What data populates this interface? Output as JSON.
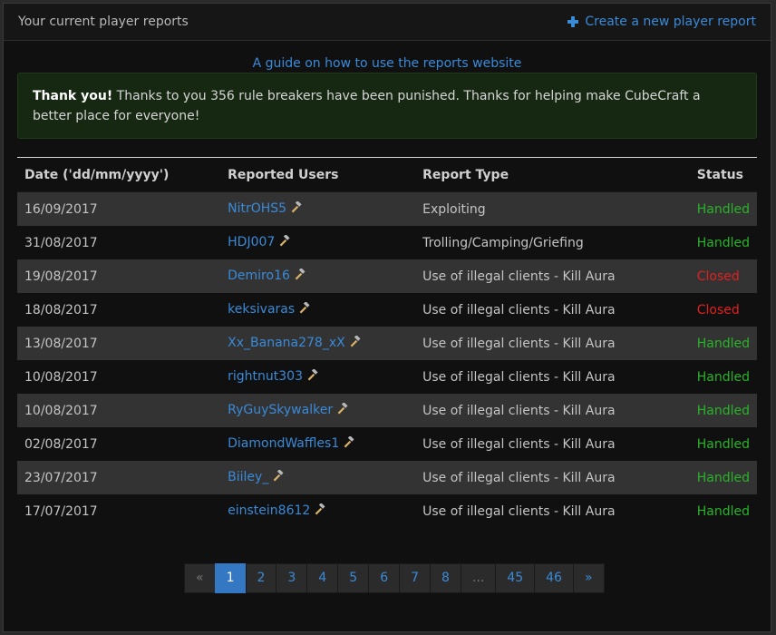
{
  "header": {
    "title": "Your current player reports",
    "create_label": "Create a new player report"
  },
  "guide_link": "A guide on how to use the reports website",
  "alert": {
    "strong": "Thank you!",
    "text": " Thanks to you 356 rule breakers have been punished. Thanks for helping make CubeCraft a better place for everyone!"
  },
  "table": {
    "columns": [
      "Date ('dd/mm/yyyy')",
      "Reported Users",
      "Report Type",
      "Status"
    ],
    "rows": [
      {
        "date": "16/09/2017",
        "user": "NitrOHS5",
        "type": "Exploiting",
        "status": "Handled"
      },
      {
        "date": "31/08/2017",
        "user": "HDJ007",
        "type": "Trolling/Camping/Griefing",
        "status": "Handled"
      },
      {
        "date": "19/08/2017",
        "user": "Demiro16",
        "type": "Use of illegal clients - Kill Aura",
        "status": "Closed"
      },
      {
        "date": "18/08/2017",
        "user": "keksivaras",
        "type": "Use of illegal clients - Kill Aura",
        "status": "Closed"
      },
      {
        "date": "13/08/2017",
        "user": "Xx_Banana278_xX",
        "type": "Use of illegal clients - Kill Aura",
        "status": "Handled"
      },
      {
        "date": "10/08/2017",
        "user": "rightnut303",
        "type": "Use of illegal clients - Kill Aura",
        "status": "Handled"
      },
      {
        "date": "10/08/2017",
        "user": "RyGuySkywalker",
        "type": "Use of illegal clients - Kill Aura",
        "status": "Handled"
      },
      {
        "date": "02/08/2017",
        "user": "DiamondWaffles1",
        "type": "Use of illegal clients - Kill Aura",
        "status": "Handled"
      },
      {
        "date": "23/07/2017",
        "user": "Biiley_",
        "type": "Use of illegal clients - Kill Aura",
        "status": "Handled"
      },
      {
        "date": "17/07/2017",
        "user": "einstein8612",
        "type": "Use of illegal clients - Kill Aura",
        "status": "Handled"
      }
    ]
  },
  "pagination": {
    "prev": "«",
    "pages": [
      "1",
      "2",
      "3",
      "4",
      "5",
      "6",
      "7",
      "8",
      "...",
      "45",
      "46"
    ],
    "next": "»",
    "current": "1"
  },
  "colors": {
    "link": "#3a8ad8",
    "handled": "#29b329",
    "closed": "#e02020",
    "alert_bg": "#162712",
    "active_page": "#3478c4"
  },
  "icons": {
    "create": "plus-icon",
    "user_action": "hammer-icon"
  }
}
